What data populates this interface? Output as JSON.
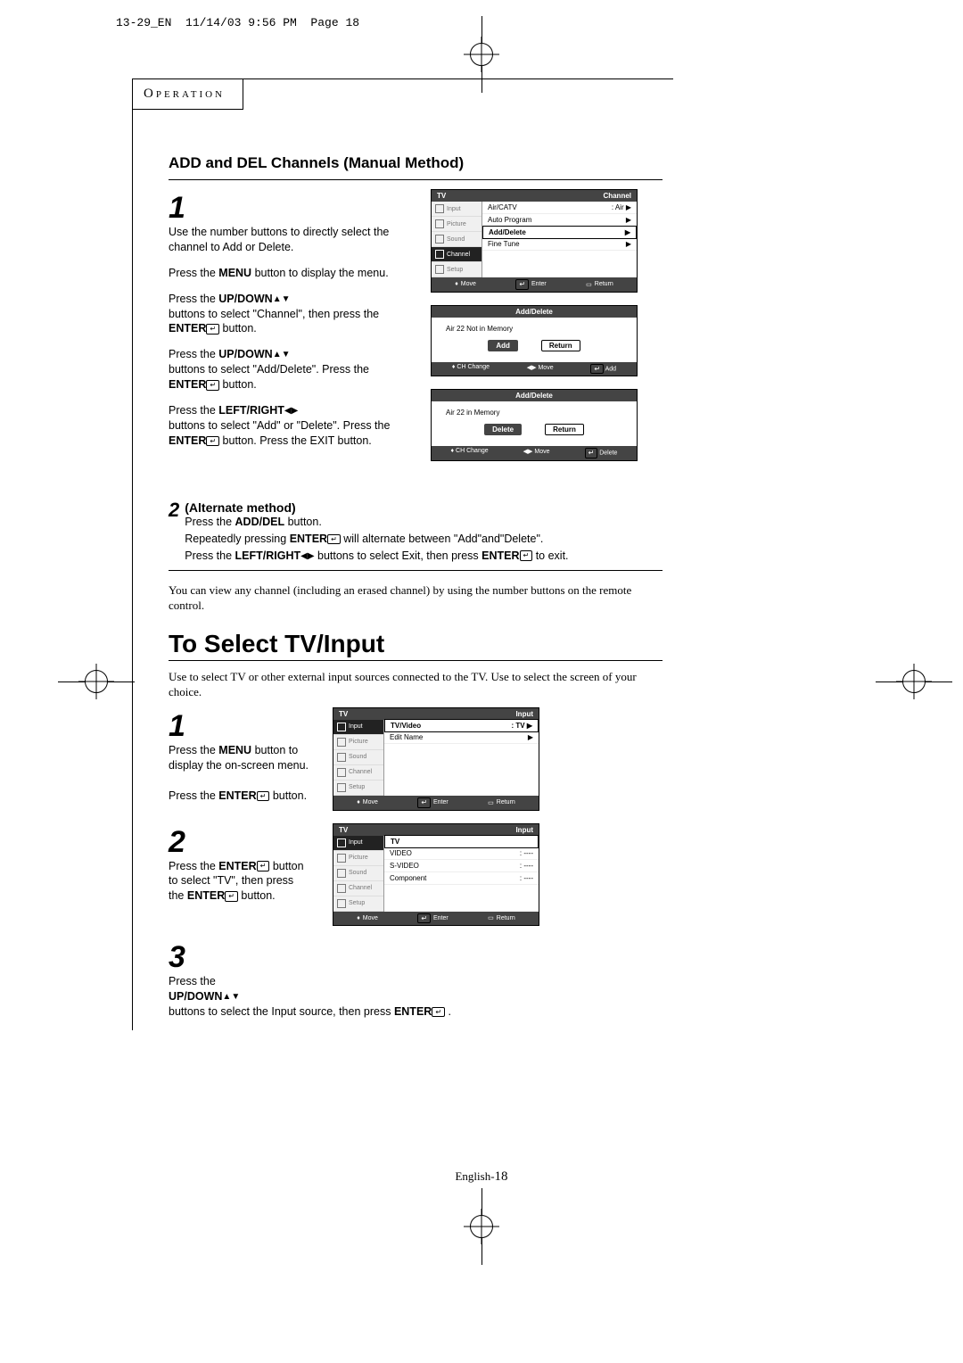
{
  "header_strip": "13-29_EN  11/14/03 9:56 PM  Page 18",
  "section_header": "Operation",
  "section1": {
    "title": "ADD and DEL Channels (Manual Method)",
    "step1": {
      "num": "1",
      "p1": "Use the number buttons to directly select the channel to Add or Delete.",
      "p2a": "Press the ",
      "p2b": "MENU",
      "p2c": " button to display the menu.",
      "p3a": "Press the ",
      "p3b": "UP/DOWN",
      "p3c": " buttons to select \"Channel\", then press the ",
      "p3d": "ENTER",
      "p3e": " button.",
      "p4a": "Press the ",
      "p4b": "UP/DOWN",
      "p4c": " buttons to select \"Add/Delete\". Press the ",
      "p4d": "ENTER",
      "p4e": " button.",
      "p5a": "Press the ",
      "p5b": "LEFT/RIGHT",
      "p5c": " buttons to select \"Add\" or \"Delete\". Press the ",
      "p5d": "ENTER",
      "p5e": " button. Press the EXIT button."
    },
    "alt": {
      "num": "2",
      "label": "(Alternate method)",
      "l1a": "Press the ",
      "l1b": "ADD/DEL",
      "l1c": " button.",
      "l2a": "Repeatedly pressing ",
      "l2b": "ENTER",
      "l2c": " will alternate between \"Add\"and\"Delete\".",
      "l3a": "Press the ",
      "l3b": "LEFT/RIGHT",
      "l3c": " buttons to select Exit, then press ",
      "l3d": "ENTER",
      "l3e": " to exit."
    },
    "note": "You can view any channel (including an erased channel) by using the number buttons on the remote control."
  },
  "osd1": {
    "title_l": "TV",
    "title_r": "Channel",
    "tabs": [
      "Input",
      "Picture",
      "Sound",
      "Channel",
      "Setup"
    ],
    "rows": [
      {
        "l": "Air/CATV",
        "r": ": Air",
        "sel": false,
        "arrow": true
      },
      {
        "l": "Auto Program",
        "r": "",
        "sel": false,
        "arrow": true
      },
      {
        "l": "Add/Delete",
        "r": "",
        "sel": true,
        "arrow": true
      },
      {
        "l": "Fine Tune",
        "r": "",
        "sel": false,
        "arrow": true
      }
    ],
    "foot": [
      "Move",
      "Enter",
      "Return"
    ]
  },
  "osd2": {
    "title": "Add/Delete",
    "line": "Air 22    Not in Memory",
    "btn1": "Add",
    "btn2": "Return",
    "foot": [
      "CH Change",
      "Move",
      "Add"
    ]
  },
  "osd3": {
    "title": "Add/Delete",
    "line": "Air 22    in Memory",
    "btn1": "Delete",
    "btn2": "Return",
    "foot": [
      "CH Change",
      "Move",
      "Delete"
    ]
  },
  "section2": {
    "title": "To Select TV/Input",
    "intro": "Use to select TV or other external input sources connected to the TV. Use to select the screen of your choice.",
    "s1": {
      "num": "1",
      "a": "Press the ",
      "b": "MENU",
      "c": " button to display the on-screen menu.",
      "d": "Press the ",
      "e": "ENTER",
      "f": " button."
    },
    "s2": {
      "num": "2",
      "a": "Press the ",
      "b": "ENTER",
      "c": " button to select \"TV\", then press the ",
      "d": "ENTER",
      "e": " button."
    },
    "s3": {
      "num": "3",
      "a": "Press the ",
      "b": "UP/DOWN",
      "c": " buttons to select the Input source, then press ",
      "d": "ENTER",
      "e": " ."
    }
  },
  "osd4": {
    "title_l": "TV",
    "title_r": "Input",
    "tabs": [
      "Input",
      "Picture",
      "Sound",
      "Channel",
      "Setup"
    ],
    "rows": [
      {
        "l": "TV/Video",
        "r": ": TV",
        "sel": true,
        "arrow": true
      },
      {
        "l": "Edit Name",
        "r": "",
        "sel": false,
        "arrow": true
      }
    ],
    "foot": [
      "Move",
      "Enter",
      "Return"
    ]
  },
  "osd5": {
    "title_l": "TV",
    "title_r": "Input",
    "tabs": [
      "Input",
      "Picture",
      "Sound",
      "Channel",
      "Setup"
    ],
    "rows": [
      {
        "l": "TV",
        "r": "",
        "sel": true,
        "arrow": false
      },
      {
        "l": "VIDEO",
        "r": ": ----",
        "sel": false,
        "arrow": false
      },
      {
        "l": "S-VIDEO",
        "r": ": ----",
        "sel": false,
        "arrow": false
      },
      {
        "l": "Component",
        "r": ": ----",
        "sel": false,
        "arrow": false
      }
    ],
    "foot": [
      "Move",
      "Enter",
      "Return"
    ]
  },
  "footer": {
    "lang": "English-",
    "page": "18"
  }
}
